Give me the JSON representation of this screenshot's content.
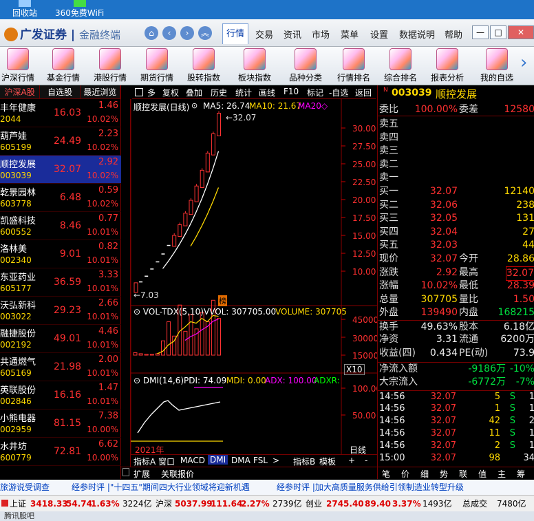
{
  "desktop": {
    "icons": [
      {
        "label": "回收站"
      },
      {
        "label": "360免费WiFi"
      }
    ]
  },
  "app": {
    "brand": "广发证券",
    "product": "金融终端",
    "menus": [
      "行情",
      "交易",
      "资讯",
      "市场",
      "菜单",
      "设置",
      "数据说明",
      "帮助"
    ],
    "active_menu": "行情"
  },
  "toolbar": {
    "items": [
      "沪深行情",
      "基金行情",
      "港股行情",
      "期货行情",
      "股转指数",
      "板块指数",
      "品种分类",
      "行情排名",
      "综合排名",
      "报表分析",
      "我的自选"
    ]
  },
  "stocklist": {
    "tabs": [
      "沪深A股",
      "自选股",
      "最近浏览"
    ],
    "rows": [
      {
        "name": "丰年健康",
        "code": "2044",
        "price": "16.03",
        "chg": "1.46",
        "pct": "10.02%"
      },
      {
        "name": "葫芦娃",
        "code": "605199",
        "price": "24.49",
        "chg": "2.23",
        "pct": "10.02%"
      },
      {
        "name": "顺控发展",
        "code": "003039",
        "price": "32.07",
        "chg": "2.92",
        "pct": "10.02%"
      },
      {
        "name": "乾景园林",
        "code": "603778",
        "price": "6.48",
        "chg": "0.59",
        "pct": "10.02%"
      },
      {
        "name": "凯盛科技",
        "code": "600552",
        "price": "8.46",
        "chg": "0.77",
        "pct": "10.01%"
      },
      {
        "name": "洛林美",
        "code": "002340",
        "price": "9.01",
        "chg": "0.82",
        "pct": "10.01%"
      },
      {
        "name": "东亚药业",
        "code": "605177",
        "price": "36.59",
        "chg": "3.33",
        "pct": "10.01%"
      },
      {
        "name": "沃弘新科",
        "code": "003022",
        "price": "29.23",
        "chg": "2.66",
        "pct": "10.01%"
      },
      {
        "name": "融捷股份",
        "code": "002192",
        "price": "49.01",
        "chg": "4.46",
        "pct": "10.01%"
      },
      {
        "name": "共通燃气",
        "code": "605169",
        "price": "21.98",
        "chg": "2.00",
        "pct": "10.01%"
      },
      {
        "name": "英联股份",
        "code": "002846",
        "price": "16.16",
        "chg": "1.47",
        "pct": "10.01%"
      },
      {
        "name": "小熊电器",
        "code": "002959",
        "price": "81.15",
        "chg": "7.38",
        "pct": "10.00%"
      },
      {
        "name": "水井坊",
        "code": "600779",
        "price": "72.81",
        "chg": "6.62",
        "pct": "10.00%"
      }
    ]
  },
  "chart": {
    "toolbar": [
      "多",
      "复权",
      "叠加",
      "历史",
      "统计",
      "画线",
      "F10",
      "标记",
      "-自选",
      "返回"
    ],
    "title": "顺控发展(日线)",
    "ma5": "MA5: 26.74",
    "ma10": "MA10: 21.67",
    "ma20": "MA20◇",
    "high_label": "←32.07",
    "low_label": "←7.03",
    "tag": "榜",
    "yticks": [
      "30.00",
      "27.50",
      "25.00",
      "22.50",
      "20.00",
      "17.50",
      "15.00",
      "12.50",
      "10.00"
    ],
    "vol": {
      "title": "VOL-TDX(5,10)",
      "vvol": "VVOL: 307705.00",
      "volume": "VOLUME: 307705",
      "yticks": [
        "45000",
        "30000",
        "15000"
      ],
      "unit": "X10"
    },
    "dmi": {
      "title": "DMI(14,6)",
      "pdi": "PDI: 74.09",
      "mdi": "MDI: 0.00",
      "adx": "ADX: 100.00",
      "adxr": "ADXR:",
      "yticks": [
        "100.00",
        "50.00"
      ]
    },
    "year": "2021年",
    "period": "日线",
    "tabs": [
      "指标A",
      "窗口",
      "MACD",
      "DMI",
      "DMA",
      "FSL",
      ">"
    ],
    "tabs2": [
      "指标B",
      "模板",
      "+",
      "-"
    ],
    "expand": [
      "扩展",
      "关联报价"
    ]
  },
  "chart_data": {
    "type": "candlestick",
    "title": "顺控发展(日线)",
    "close": [
      7.03,
      8.5,
      9.3,
      10.3,
      11.3,
      12.4,
      13.6,
      15.0,
      16.5,
      18.1,
      19.9,
      21.9,
      24.1,
      26.5,
      29.2,
      32.07
    ],
    "volume": [
      2000,
      1200,
      800,
      700,
      1200,
      12000,
      28000,
      16000,
      42000,
      20000,
      34000,
      22000,
      36000,
      28000,
      46000,
      30770
    ]
  },
  "quote": {
    "code": "003039",
    "name": "顺控发展",
    "weibi_label": "委比",
    "weibi": "100.00%",
    "weicha_label": "委差",
    "weicha": "12580",
    "sell": [
      {
        "label": "卖五"
      },
      {
        "label": "卖四"
      },
      {
        "label": "卖三"
      },
      {
        "label": "卖二"
      },
      {
        "label": "卖一"
      }
    ],
    "buy": [
      {
        "label": "买一",
        "price": "32.07",
        "vol": "12140"
      },
      {
        "label": "买二",
        "price": "32.06",
        "vol": "238"
      },
      {
        "label": "买三",
        "price": "32.05",
        "vol": "131"
      },
      {
        "label": "买四",
        "price": "32.04",
        "vol": "27"
      },
      {
        "label": "买五",
        "price": "32.03",
        "vol": "44"
      }
    ],
    "stats": [
      {
        "l1": "现价",
        "v1": "32.07",
        "l2": "今开",
        "v2": "28.86"
      },
      {
        "l1": "涨跌",
        "v1": "2.92",
        "l2": "最高",
        "v2": "32.07"
      },
      {
        "l1": "涨幅",
        "v1": "10.02%",
        "l2": "最低",
        "v2": "28.39"
      },
      {
        "l1": "总量",
        "v1": "307705",
        "l2": "量比",
        "v2": "1.50"
      },
      {
        "l1": "外盘",
        "v1": "139490",
        "l2": "内盘",
        "v2": "168215"
      },
      {
        "l1": "换手",
        "v1": "49.63%",
        "l2": "股本",
        "v2": "6.18亿"
      },
      {
        "l1": "净资",
        "v1": "3.31",
        "l2": "流通",
        "v2": "6200万"
      },
      {
        "l1": "收益(四)",
        "v1": "0.434",
        "l2": "PE(动)",
        "v2": "73.9"
      }
    ],
    "flow": [
      {
        "label": "净流入额",
        "v": "-9186万",
        "p": "-10%"
      },
      {
        "label": "大宗流入",
        "v": "-6772万",
        "p": "-7%"
      }
    ],
    "ticks": [
      {
        "t": "14:56",
        "p": "32.07",
        "v": "5",
        "s": "S",
        "n": "1"
      },
      {
        "t": "14:56",
        "p": "32.07",
        "v": "1",
        "s": "S",
        "n": "1"
      },
      {
        "t": "14:56",
        "p": "32.07",
        "v": "42",
        "s": "S",
        "n": "2"
      },
      {
        "t": "14:56",
        "p": "32.07",
        "v": "11",
        "s": "S",
        "n": "1"
      },
      {
        "t": "14:56",
        "p": "32.07",
        "v": "2",
        "s": "S",
        "n": "1"
      },
      {
        "t": "15:00",
        "p": "32.07",
        "v": "98",
        "s": "",
        "n": "34"
      }
    ],
    "tabs": [
      "笔",
      "价",
      "细",
      "势",
      "联",
      "值",
      "主",
      "筹"
    ]
  },
  "news": [
    "旅游说受调查",
    "经参时评 |\"十四五\"期间四大行业领域将迎新机遇",
    "经参时评 |加大高质量服务供给引领制造业转型升级"
  ],
  "indexbar": {
    "sh_label": "上证",
    "sh": "3418.33",
    "sh_chg": "54.74",
    "sh_pct": "1.63%",
    "sh_amt": "3224亿",
    "sz_label": "沪深",
    "sz": "5037.99",
    "sz_chg": "111.64",
    "sz_pct": "2.27%",
    "sz_amt": "2739亿",
    "cy_label": "创业",
    "cy": "2745.40",
    "cy_chg": "89.40",
    "cy_pct": "3.37%",
    "cy_amt": "1493亿",
    "total_label": "总成交",
    "total": "7480亿"
  },
  "status": "腾讯股吧"
}
